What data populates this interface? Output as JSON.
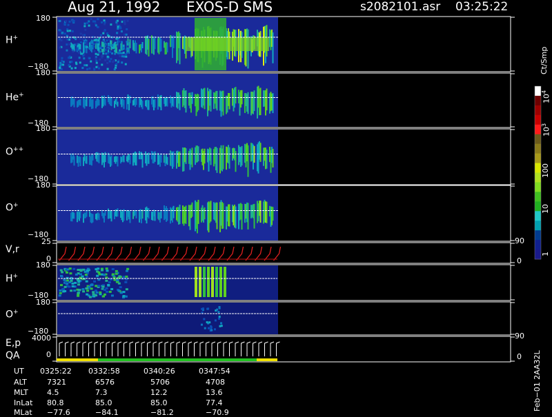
{
  "header": {
    "date": "Aug 21, 1992",
    "instrument": "EXOS-D SMS",
    "file": "s2082101.asr",
    "time": "03:25:22"
  },
  "panels": [
    {
      "id": "hplus",
      "label": "H",
      "sup": "+",
      "y_top": "180",
      "y_bottom": "−180"
    },
    {
      "id": "heplus",
      "label": "He",
      "sup": "+",
      "y_top": "180",
      "y_bottom": "−180"
    },
    {
      "id": "opp",
      "label": "O",
      "sup": "++",
      "y_top": "180",
      "y_bottom": "−180"
    },
    {
      "id": "oplus",
      "label": "O",
      "sup": "+",
      "y_top": "180",
      "y_bottom": "−180"
    },
    {
      "id": "vr",
      "label": "V,r",
      "sup": "",
      "y_top": "25",
      "y_bottom": "0",
      "right_top": "90",
      "right_bottom": "0"
    },
    {
      "id": "hplus2",
      "label": "H",
      "sup": "+",
      "y_top": "180",
      "y_bottom": "−180"
    },
    {
      "id": "oplus2",
      "label": "O",
      "sup": "+",
      "y_top": "180",
      "y_bottom": "−180"
    },
    {
      "id": "ep",
      "label": "E,p",
      "label2": "QA",
      "sup": "",
      "y_top": "4000",
      "y_bottom": "0",
      "right_top": "90",
      "right_bottom": "0"
    }
  ],
  "colorbar": {
    "unit": "Ct/Smp",
    "labels": [
      "10",
      "10",
      "100",
      "10",
      "1"
    ],
    "sup": [
      "4",
      "3",
      "",
      "",
      ""
    ],
    "colors": [
      "#ffffff",
      "#6e0000",
      "#9e0000",
      "#c80000",
      "#ff1a1a",
      "#6b5a1a",
      "#8a7a1a",
      "#a89a1a",
      "#d8e600",
      "#b0e020",
      "#80dc20",
      "#40c020",
      "#20b020",
      "#20c8c8",
      "#00a0b0",
      "#003c90",
      "#102090",
      "#1a1a8c"
    ]
  },
  "ephemeris": {
    "rows": [
      {
        "label": "UT",
        "values": [
          "0325:22",
          "0332:58",
          "0340:26",
          "0347:54"
        ]
      },
      {
        "label": "ALT",
        "values": [
          "7321",
          "6576",
          "5706",
          "4708"
        ]
      },
      {
        "label": "MLT",
        "values": [
          "4.5",
          "7.3",
          "12.2",
          "13.6"
        ]
      },
      {
        "label": "InLat",
        "values": [
          "80.8",
          "85.0",
          "85.0",
          "77.4"
        ]
      },
      {
        "label": "MLat",
        "values": [
          "−77.6",
          "−84.1",
          "−81.2",
          "−70.9"
        ]
      }
    ]
  },
  "footer_code": "Feb−01 2AA32L",
  "chart_data": {
    "type": "heatmap",
    "title": "Aug 21, 1992   EXOS-D SMS",
    "x_tick_labels": [
      "0325:22",
      "0332:58",
      "0340:26",
      "0347:54"
    ],
    "panels": [
      "H+",
      "He+",
      "O++",
      "O+",
      "V,r",
      "H+",
      "O+",
      "E,p QA"
    ],
    "pitch_angle_range": [
      -180,
      180
    ],
    "colorbar_range": [
      1,
      10000
    ],
    "colorbar_scale": "log",
    "colorbar_unit": "Ct/Smp"
  }
}
